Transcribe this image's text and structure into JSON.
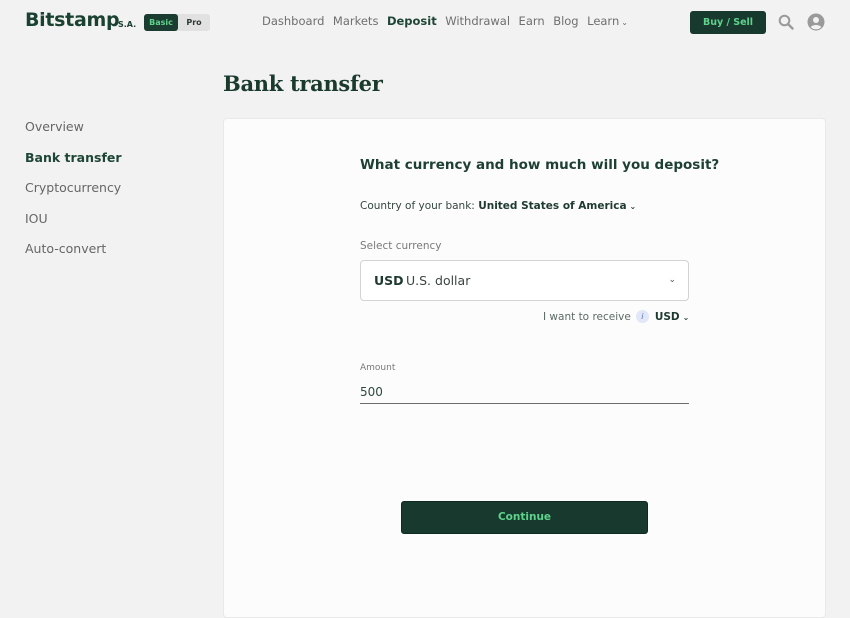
{
  "header": {
    "logo": "Bitstamp",
    "logo_suffix": "S.A.",
    "mode_toggle": {
      "basic": "Basic",
      "pro": "Pro",
      "selected": "Basic"
    },
    "nav": [
      {
        "label": "Dashboard"
      },
      {
        "label": "Markets"
      },
      {
        "label": "Deposit",
        "active": true
      },
      {
        "label": "Withdrawal"
      },
      {
        "label": "Earn"
      },
      {
        "label": "Blog"
      },
      {
        "label": "Learn"
      }
    ],
    "buy_sell_label": "Buy / Sell",
    "icons": {
      "search": "search-icon",
      "account": "user-icon"
    }
  },
  "page": {
    "title": "Bank transfer"
  },
  "sidebar": {
    "items": [
      {
        "label": "Overview"
      },
      {
        "label": "Bank transfer",
        "active": true
      },
      {
        "label": "Cryptocurrency"
      },
      {
        "label": "IOU"
      },
      {
        "label": "Auto-convert"
      }
    ]
  },
  "form": {
    "heading": "What currency and how much will you deposit?",
    "country_label": "Country of your bank:",
    "country_value": "United States of America",
    "currency_label": "Select currency",
    "currency_code": "USD",
    "currency_name": "U.S. dollar",
    "receive_label": "I want to receive",
    "receive_value": "USD",
    "amount_label": "Amount",
    "amount_value": "500",
    "continue_label": "Continue"
  },
  "colors": {
    "brand_dark": "#17392e",
    "brand_green": "#5fd28b",
    "background": "#f2f2f2",
    "card": "#fcfcfc"
  }
}
